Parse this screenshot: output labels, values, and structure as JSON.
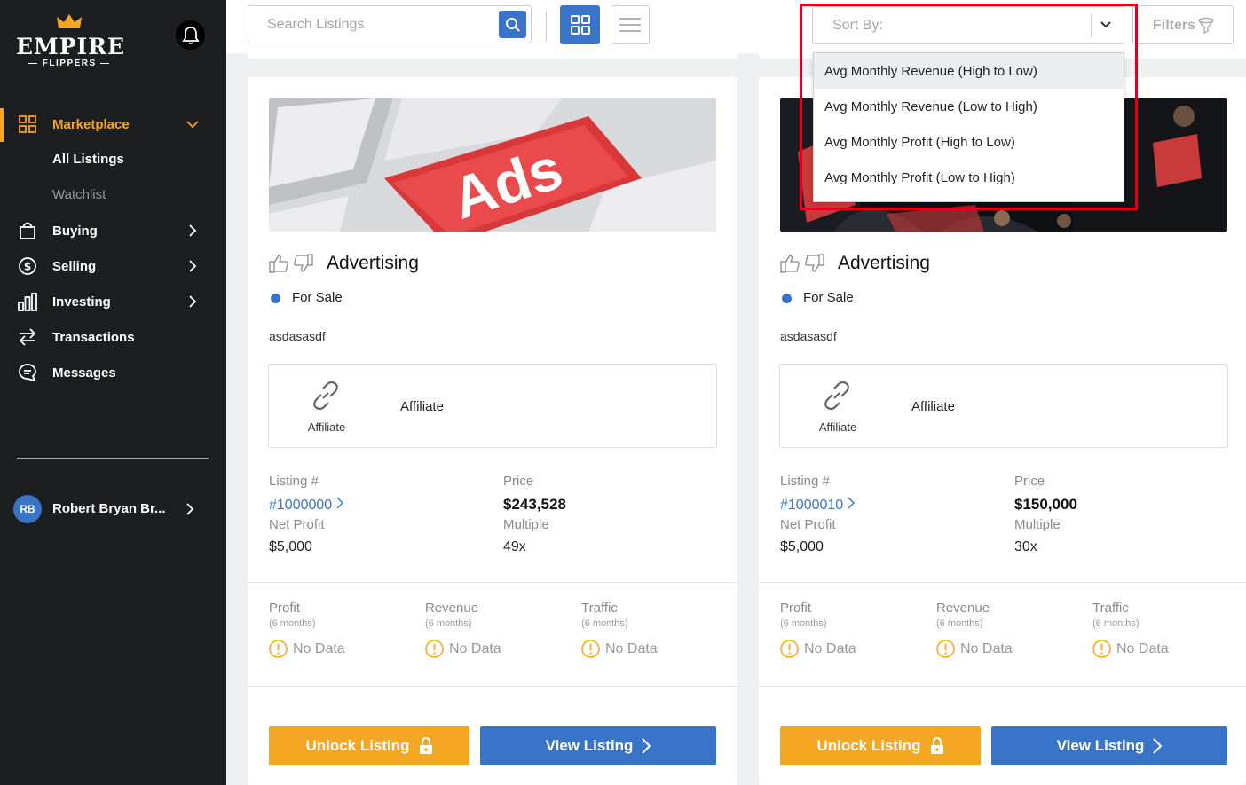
{
  "brand": {
    "name": "EMPIRE",
    "sub": "— FLIPPERS —",
    "crown_color": "#f5a623"
  },
  "colors": {
    "accent": "#f5a623",
    "primary": "#3a74c9",
    "sidebar_bg": "#1d1e20",
    "highlight": "#e0001a"
  },
  "sidebar": {
    "marketplace": "Marketplace",
    "sub_items": [
      "All Listings",
      "Watchlist"
    ],
    "items": [
      {
        "label": "Buying",
        "icon": "bag-icon"
      },
      {
        "label": "Selling",
        "icon": "dollar-circle-icon"
      },
      {
        "label": "Investing",
        "icon": "bar-chart-icon"
      },
      {
        "label": "Transactions",
        "icon": "arrows-swap-icon"
      },
      {
        "label": "Messages",
        "icon": "chat-icon"
      }
    ],
    "user": {
      "initials": "RB",
      "name": "Robert Bryan Br..."
    }
  },
  "topbar": {
    "search_placeholder": "Search Listings",
    "sort_placeholder": "Sort By:",
    "filters_label": "Filters"
  },
  "sort_menu": {
    "options": [
      "Avg Monthly Revenue (High to Low)",
      "Avg Monthly Revenue (Low to High)",
      "Avg Monthly Profit (High to Low)",
      "Avg Monthly Profit (Low to High)"
    ],
    "highlighted_index": 0
  },
  "listings": [
    {
      "image_text": "Ads",
      "category": "Advertising",
      "status": "For Sale",
      "description": "asdasasdf",
      "monetization": "Affiliate",
      "monetization_icon_label": "Affiliate",
      "listing_label": "Listing #",
      "listing_number": "#1000000",
      "price_label": "Price",
      "price": "$243,528",
      "net_profit_label": "Net Profit",
      "net_profit": "$5,000",
      "multiple_label": "Multiple",
      "multiple": "49x",
      "metrics": [
        {
          "title": "Profit",
          "sub": "(6 months)",
          "value": "No Data"
        },
        {
          "title": "Revenue",
          "sub": "(6 months)",
          "value": "No Data"
        },
        {
          "title": "Traffic",
          "sub": "(6 months)",
          "value": "No Data"
        }
      ],
      "unlock_label": "Unlock Listing",
      "view_label": "View Listing"
    },
    {
      "image_text": "",
      "category": "Advertising",
      "status": "For Sale",
      "description": "asdasasdf",
      "monetization": "Affiliate",
      "monetization_icon_label": "Affiliate",
      "listing_label": "Listing #",
      "listing_number": "#1000010",
      "price_label": "Price",
      "price": "$150,000",
      "net_profit_label": "Net Profit",
      "net_profit": "$5,000",
      "multiple_label": "Multiple",
      "multiple": "30x",
      "metrics": [
        {
          "title": "Profit",
          "sub": "(6 months)",
          "value": "No Data"
        },
        {
          "title": "Revenue",
          "sub": "(6 months)",
          "value": "No Data"
        },
        {
          "title": "Traffic",
          "sub": "(6 months)",
          "value": "No Data"
        }
      ],
      "unlock_label": "Unlock Listing",
      "view_label": "View Listing"
    }
  ]
}
